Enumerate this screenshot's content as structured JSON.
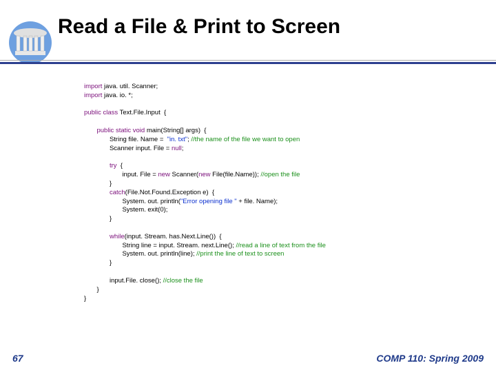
{
  "title": "Read a File & Print to Screen",
  "footer": {
    "left": "67",
    "right": "COMP 110: Spring 2009"
  },
  "code": {
    "l01a": "import",
    "l01b": " java. util. Scanner;",
    "l02a": "import",
    "l02b": " java. io. *;",
    "l03a": "public",
    "l03b": " class",
    "l03c": " Text.File.Input  {",
    "l04a": "public",
    "l04b": " static",
    "l04c": " void",
    "l04d": " main(String[] args)  {",
    "l05a": "String file. Name =  ",
    "l05b": "\"in. txt\"",
    "l05c": "; ",
    "l05d": "//the name of the file we want to open",
    "l06a": "Scanner input. File = ",
    "l06b": "null",
    "l06c": ";",
    "l07a": "try",
    "l07b": "  {",
    "l08a": "input. File = ",
    "l08b": "new",
    "l08c": " Scanner(",
    "l08d": "new",
    "l08e": " File(file.Name)); ",
    "l08f": "//open the file",
    "l09": "}",
    "l10a": "catch",
    "l10b": "(File.Not.Found.Exception e)  {",
    "l11a": "System. out. println(",
    "l11b": "\"Error opening file \"",
    "l11c": " + file. Name);",
    "l12": "System. exit(0);",
    "l13": "}",
    "l14a": "while",
    "l14b": "(input. Stream. has.Next.Line())  {",
    "l15a": "String line = input. Stream. next.Line(); ",
    "l15b": "//read a line of text from the file",
    "l16a": "System. out. println(line); ",
    "l16b": "//print the line of text to screen",
    "l17": "}",
    "l18a": "input.File. close(); ",
    "l18b": "//close the file",
    "l19": "}",
    "l20": "}"
  }
}
